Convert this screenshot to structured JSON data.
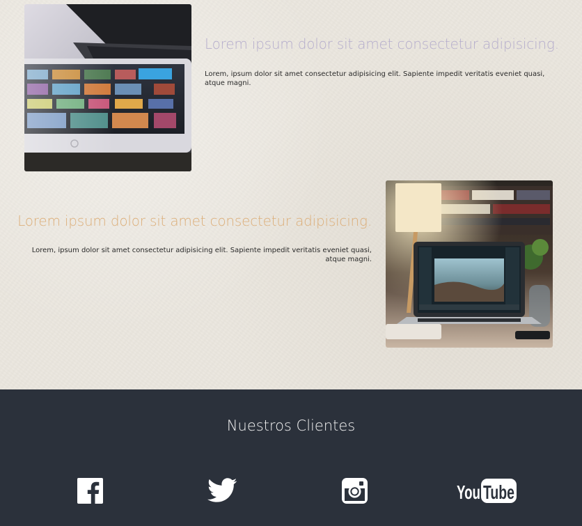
{
  "features": [
    {
      "title": "Lorem ipsum dolor sit amet consectetur adipisicing.",
      "text": "Lorem, ipsum dolor sit amet consectetur adipisicing elit. Sapiente impedit veritatis eveniet quasi, atque magni.",
      "image": "tablet-streaming-app-photo",
      "title_color": "#b5adcc"
    },
    {
      "title": "Lorem ipsum dolor sit amet consectetur adipisicing.",
      "text": "Lorem, ipsum dolor sit amet consectetur adipisicing elit. Sapiente impedit veritatis eveniet quasi, atque magni.",
      "image": "laptop-photo-editor-desk-photo",
      "title_color": "#dcae79"
    }
  ],
  "clients": {
    "title": "Nuestros Clientes",
    "background": "#2b313b",
    "icons": [
      "facebook-icon",
      "twitter-icon",
      "instagram-icon",
      "youtube-icon"
    ],
    "youtube_wordmark": {
      "you": "You",
      "tube": "Tube"
    }
  }
}
